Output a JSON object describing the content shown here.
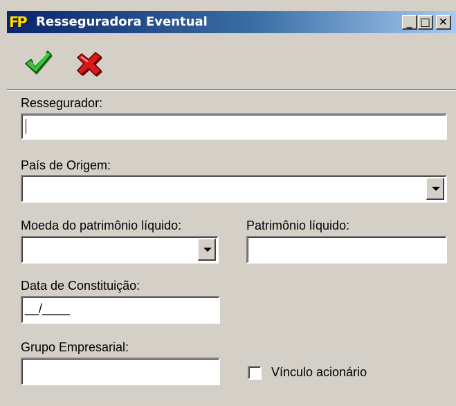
{
  "window": {
    "app_icon": "FP",
    "title": "Resseguradora Eventual",
    "minimize_label": "_",
    "maximize_label": "□",
    "close_label": "✕"
  },
  "toolbar": {
    "confirm_icon": "green-check-icon",
    "cancel_icon": "red-x-icon"
  },
  "form": {
    "ressegurador": {
      "label": "Ressegurador:",
      "value": ""
    },
    "pais_origem": {
      "label": "País de Origem:",
      "value": ""
    },
    "moeda": {
      "label": "Moeda do patrimônio líquido:",
      "value": ""
    },
    "patrimonio": {
      "label": "Patrimônio líquido:",
      "value": ""
    },
    "data_constituicao": {
      "label": "Data de Constituição:",
      "value": "__/____"
    },
    "grupo_empresarial": {
      "label": "Grupo Empresarial:",
      "value": ""
    },
    "vinculo": {
      "label": "Vínculo acionário",
      "checked": false
    }
  },
  "colors": {
    "face": "#d4d0c8",
    "title_start": "#0a246a",
    "title_end": "#a6caf0",
    "confirm": "#2f9e2f",
    "cancel": "#c00000"
  }
}
